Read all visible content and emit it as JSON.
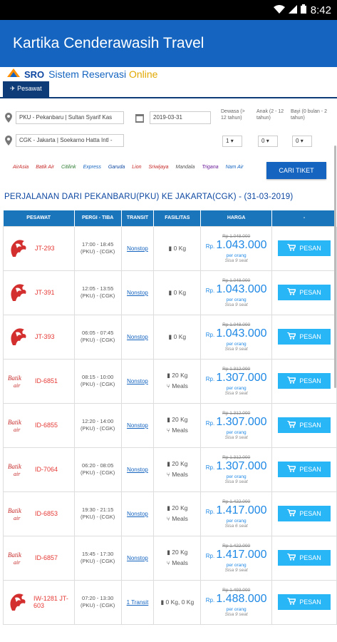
{
  "status": {
    "time": "8:42"
  },
  "app": {
    "title": "Kartika Cenderawasih Travel"
  },
  "brand": {
    "sro": "SRO",
    "title_main": "Sistem Reservasi",
    "title_online": "Online"
  },
  "tab": {
    "label": "Pesawat"
  },
  "form": {
    "origin": "PKU - Pekanbaru | Sultan Syarif Kas",
    "destination": "CGK - Jakarta | Soekarno Hatta Intl -",
    "date": "2019-03-31",
    "adult_label": "Dewasa (> 12 tahun)",
    "child_label": "Anak (2 - 12 tahun)",
    "infant_label": "Bayi (0 bulan - 2 tahun)",
    "adult_value": "1",
    "child_value": "0",
    "infant_value": "0",
    "search_button": "CARI TIKET"
  },
  "airlines": [
    "AirAsia",
    "Batik Air",
    "Citilink",
    "Express",
    "Garuda",
    "Lion",
    "Sriwijaya",
    "Mandala",
    "Trigana",
    "Nam Air"
  ],
  "route_title": "PERJALANAN DARI PEKANBARU(PKU) KE JAKARTA(CGK) - (31-03-2019)",
  "table": {
    "headers": [
      "PESAWAT",
      "PERGI - TIBA",
      "TRANSIT",
      "FASILITAS",
      "HARGA",
      "-"
    ],
    "rows": [
      {
        "airline": "lion",
        "code": "JT-293",
        "dep": "17:00 - 18:45",
        "route": "(PKU) - (CGK)",
        "transit": "Nonstop",
        "bag": "0 Kg",
        "meals": "",
        "old": "Rp 1.048.000",
        "price": "1.043.000",
        "per": "per orang",
        "sisa": "Sisa 9 seat",
        "btn": "PESAN"
      },
      {
        "airline": "lion",
        "code": "JT-391",
        "dep": "12:05 - 13:55",
        "route": "(PKU) - (CGK)",
        "transit": "Nonstop",
        "bag": "0 Kg",
        "meals": "",
        "old": "Rp 1.048.000",
        "price": "1.043.000",
        "per": "per orang",
        "sisa": "Sisa 9 seat",
        "btn": "PESAN"
      },
      {
        "airline": "lion",
        "code": "JT-393",
        "dep": "06:05 - 07:45",
        "route": "(PKU) - (CGK)",
        "transit": "Nonstop",
        "bag": "0 Kg",
        "meals": "",
        "old": "Rp 1.048.000",
        "price": "1.043.000",
        "per": "per orang",
        "sisa": "Sisa 9 seat",
        "btn": "PESAN"
      },
      {
        "airline": "batik",
        "code": "ID-6851",
        "dep": "08:15 - 10:00",
        "route": "(PKU) - (CGK)",
        "transit": "Nonstop",
        "bag": "20 Kg",
        "meals": "Meals",
        "old": "Rp 1.312.000",
        "price": "1.307.000",
        "per": "per orang",
        "sisa": "Sisa 9 seat",
        "btn": "PESAN"
      },
      {
        "airline": "batik",
        "code": "ID-6855",
        "dep": "12:20 - 14:00",
        "route": "(PKU) - (CGK)",
        "transit": "Nonstop",
        "bag": "20 Kg",
        "meals": "Meals",
        "old": "Rp 1.312.000",
        "price": "1.307.000",
        "per": "per orang",
        "sisa": "Sisa 9 seat",
        "btn": "PESAN"
      },
      {
        "airline": "batik",
        "code": "ID-7064",
        "dep": "06:20 - 08:05",
        "route": "(PKU) - (CGK)",
        "transit": "Nonstop",
        "bag": "20 Kg",
        "meals": "Meals",
        "old": "Rp 1.312.000",
        "price": "1.307.000",
        "per": "per orang",
        "sisa": "Sisa 9 seat",
        "btn": "PESAN"
      },
      {
        "airline": "batik",
        "code": "ID-6853",
        "dep": "19:30 - 21:15",
        "route": "(PKU) - (CGK)",
        "transit": "Nonstop",
        "bag": "20 Kg",
        "meals": "Meals",
        "old": "Rp 1.422.000",
        "price": "1.417.000",
        "per": "per orang",
        "sisa": "Sisa 6 seat",
        "btn": "PESAN"
      },
      {
        "airline": "batik",
        "code": "ID-6857",
        "dep": "15:45 - 17:30",
        "route": "(PKU) - (CGK)",
        "transit": "Nonstop",
        "bag": "20 Kg",
        "meals": "Meals",
        "old": "Rp 1.422.000",
        "price": "1.417.000",
        "per": "per orang",
        "sisa": "Sisa 9 seat",
        "btn": "PESAN"
      },
      {
        "airline": "lion",
        "code": "IW-1281 JT-603",
        "dep": "07:20 - 13:30",
        "route": "(PKU) - (CGK)",
        "transit": "1 Transit",
        "bag": "0 Kg, 0 Kg",
        "meals": "",
        "old": "Rp 1.493.000",
        "price": "1.488.000",
        "per": "per orang",
        "sisa": "Sisa 9 seat",
        "btn": "PESAN"
      }
    ]
  },
  "colors": {
    "appbar": "#1565c0",
    "header": "#1b75bb",
    "button": "#29b6f6",
    "price": "#1e88e5"
  }
}
